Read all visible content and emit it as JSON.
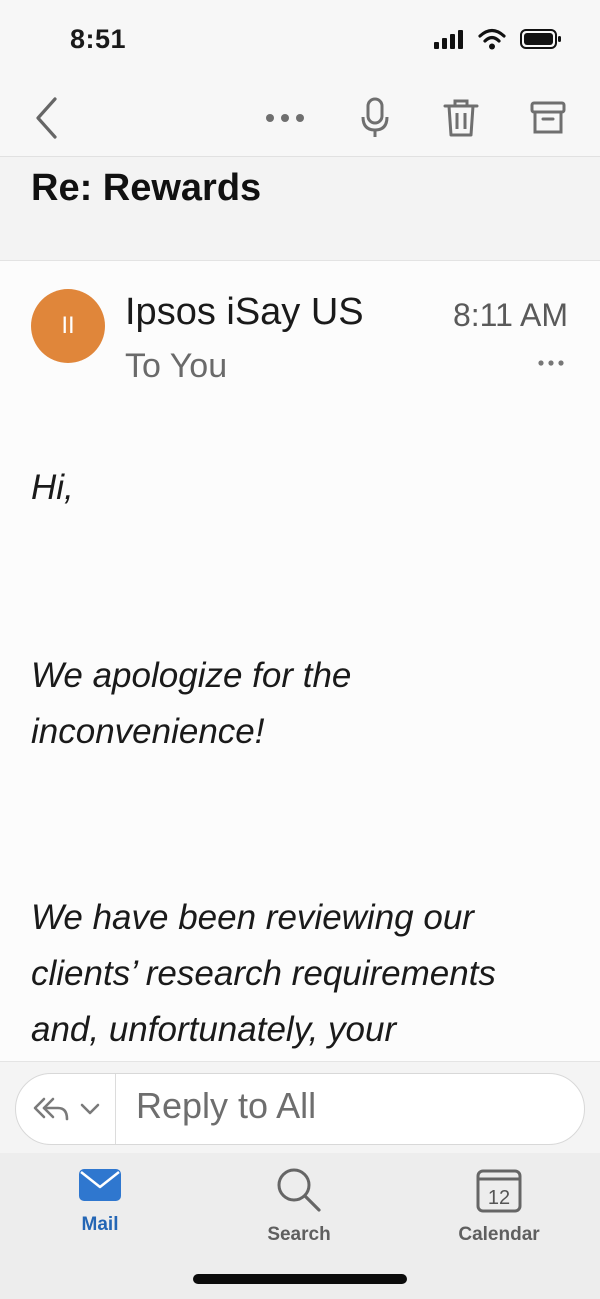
{
  "status_bar": {
    "time": "8:51"
  },
  "email": {
    "subject": "Re: Rewards",
    "avatar_initials": "II",
    "sender": "Ipsos iSay US",
    "recipient": "To You",
    "time": "8:11 AM",
    "body": [
      "Hi,",
      "We apologize for the inconvenience!",
      "We have been reviewing our clients’ research requirements and, unfortunately, your"
    ]
  },
  "reply": {
    "placeholder": "Reply to All"
  },
  "tabs": [
    {
      "label": "Mail",
      "active": true
    },
    {
      "label": "Search",
      "active": false
    },
    {
      "label": "Calendar",
      "active": false,
      "date": "12"
    }
  ],
  "colors": {
    "avatar": "#e0863a",
    "accent": "#2466b5"
  },
  "icons": [
    "signal-icon",
    "wifi-icon",
    "battery-icon",
    "back-icon",
    "more-icon",
    "microphone-icon",
    "trash-icon",
    "archive-icon",
    "reply-all-icon",
    "chevron-down-icon",
    "mail-icon",
    "search-icon",
    "calendar-icon"
  ]
}
